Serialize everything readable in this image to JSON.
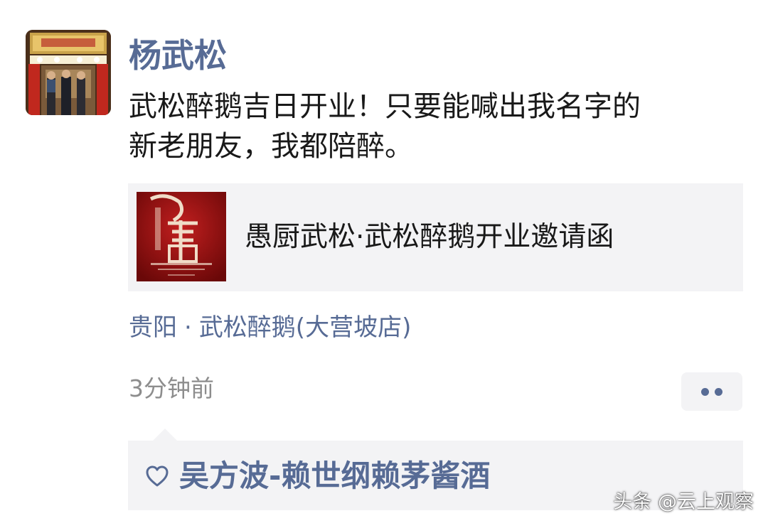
{
  "post": {
    "author": "杨武松",
    "text_line1": "武松醉鹅吉日开业！只要能喊出我名字的",
    "text_line2": "新老朋友，我都陪醉。",
    "link_card": {
      "title": "愚厨武松·武松醉鹅开业邀请函"
    },
    "location": {
      "city": "贵阳",
      "separator": "·",
      "place": "武松醉鹅(大营坡店)"
    },
    "time": "3分钟前",
    "more_icon": "ellipsis-icon",
    "likes": {
      "icon": "heart-icon",
      "names": "吴方波-赖世纲赖茅酱酒"
    }
  },
  "watermark": "头条 @云上观察",
  "colors": {
    "link_blue": "#576b95",
    "card_bg": "#f3f3f5",
    "text": "#191919",
    "meta": "#8d8d8d"
  }
}
